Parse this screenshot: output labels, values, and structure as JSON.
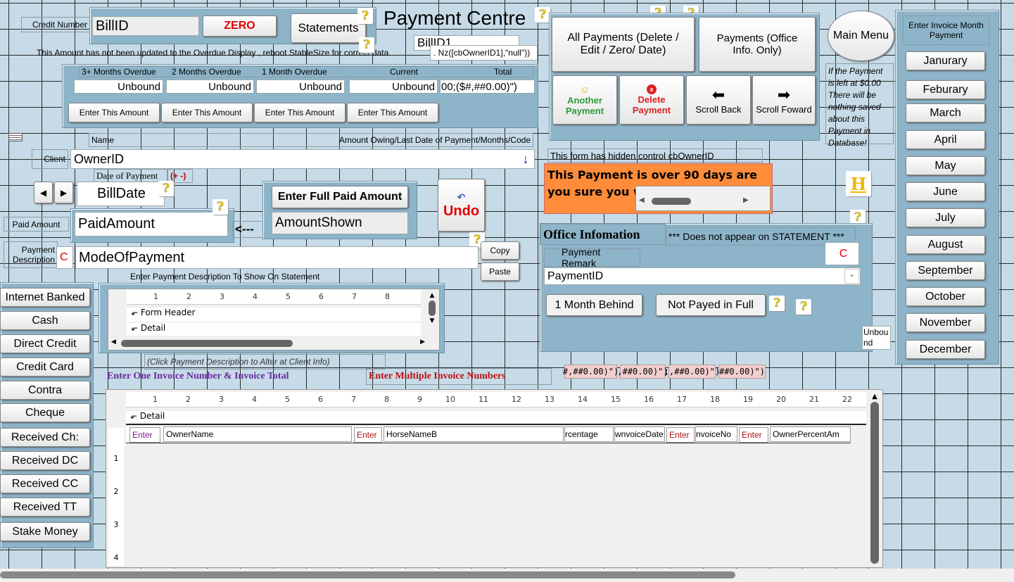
{
  "title": "Payment Centre",
  "credit_label": "Credit Number",
  "bill_id": "BillID",
  "zero_btn": "ZERO",
  "statements_btn": "Statements",
  "bill_id1": "BillID1",
  "warning": "This Amount has not been updated to the Overdue Display , reboot StableSize for correct data.",
  "nz_expr": ". Nz([cbOwnerID1],\"null\"))",
  "overdue": {
    "headers": [
      "3+ Months Overdue",
      "2 Months Overdue",
      "1 Month Overdue",
      "Current",
      "Total"
    ],
    "values": [
      "Unbound",
      "Unbound",
      "Unbound",
      "Unbound",
      "00;($#,##0.00)\")"
    ],
    "enter_btn": "Enter This Amount"
  },
  "name_label": "Name",
  "owing_label": "Amount Owing/Last Date of Payment/Months/Code",
  "client_label": "Client",
  "owner_id": "OwnerID",
  "date_label": "Date of Payment",
  "plus_minus": "(+ -)",
  "bill_date": "BillDate",
  "paid_label": "Paid Amount",
  "paid_amount": "PaidAmount",
  "arrow_text": "<---",
  "full_paid_btn": "Enter Full Paid Amount",
  "amount_shown": "AmountShown",
  "undo_btn": "Undo",
  "desc_label": "Payment Description",
  "c_label": "C",
  "mode_of_payment": "ModeOfPayment",
  "copy_btn": "Copy",
  "paste_btn": "Paste",
  "desc_hint": "Enter Payment Description To Show On Statement",
  "sub1": {
    "form_header": "Form Header",
    "detail": "Detail",
    "ruler": [
      "1",
      "2",
      "3",
      "4",
      "5",
      "6",
      "7",
      "8"
    ]
  },
  "click_hint": "(Click Payment Description to Alter at Client Info)",
  "one_invoice": "Enter One Invoice Number & Invoice Total",
  "multi_invoice": "Enter Multiple Invoice Numbers",
  "pink": [
    "#,##0.00)\")",
    ",##0.00)\")",
    ";,##0.00)\")",
    "##0.00)\")"
  ],
  "left_buttons": [
    "Internet Banked",
    "Cash",
    "Direct Credit",
    "Credit Card",
    "Contra",
    "Cheque",
    "Received Ch:",
    "Received DC",
    "Received CC",
    "Received TT",
    "Stake Money"
  ],
  "sub2": {
    "detail": "Detail",
    "ruler": [
      "1",
      "2",
      "3",
      "4",
      "5",
      "6",
      "7",
      "8",
      "9",
      "10",
      "11",
      "12",
      "13",
      "14",
      "15",
      "16",
      "17",
      "18",
      "19",
      "20",
      "21",
      "22"
    ],
    "vruler": [
      "1",
      "2",
      "3",
      "4"
    ],
    "fields": [
      "Enter",
      "OwnerName",
      "Enter",
      "HorseNameB",
      "rcentage",
      "wnvoiceDateIn",
      "Enter",
      "nvoiceNo",
      "Enter",
      "OwnerPercentAm"
    ]
  },
  "right": {
    "all_payments": "All Payments (Delete / Edit / Zero/ Date)",
    "office_payments": "Payments (Office Info. Only)",
    "another": "Another Payment",
    "delete": "Delete Payment",
    "scroll_back": "Scroll Back",
    "scroll_forward": "Scroll Foward"
  },
  "main_menu": "Main Menu",
  "note": "If the Payment is left at $0.00 There will be nothing saved about this Payment in Database!",
  "months_header": "Enter Invoice Month Payment",
  "months": [
    "Janurary",
    "Feburary",
    "March",
    "April",
    "May",
    "June",
    "July",
    "August",
    "September",
    "October",
    "November",
    "December"
  ],
  "hidden_note": "This form has hidden control cbOwnerID",
  "over90": "This Payment is over 90 days are you sure you w",
  "h_btn": "H",
  "office": {
    "title": "Office Infomation",
    "not_statement": "*** Does not appear on STATEMENT ***",
    "remark_label": "Payment Remark",
    "c": "C",
    "payment_id": "PaymentID",
    "month_behind": "1 Month Behind",
    "not_full": "Not Payed in Full"
  },
  "unbound_small": "Unbound",
  "colors": {
    "panel": "#8db4c9",
    "bg": "#c6dbe7",
    "orange": "#ff8c3a",
    "red": "#e00000",
    "green": "#2e9a3a",
    "purple": "#6a2aa0"
  }
}
